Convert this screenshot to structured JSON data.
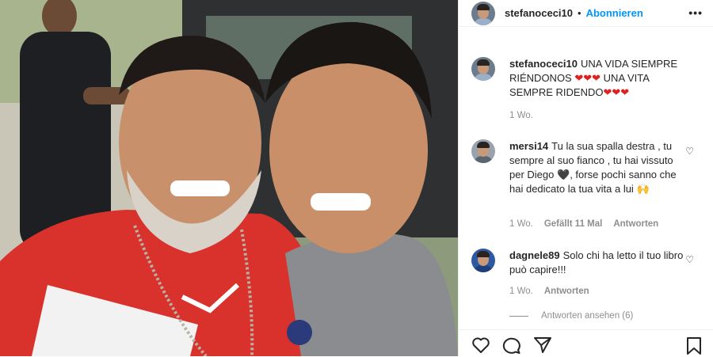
{
  "post": {
    "username": "stefanoceci10",
    "separator": "•",
    "follow_label": "Abonnieren",
    "more_label": "•••"
  },
  "caption": {
    "username": "stefanoceci10",
    "text_part1": "UNA VIDA SIEMPRE RIÉNDONOS",
    "hearts": "❤❤❤",
    "text_part2": "UNA VITA SEMPRE RIDENDO",
    "time": "1 Wo."
  },
  "comments": [
    {
      "username": "mersi14",
      "text_a": "Tu la sua spalla destra , tu sempre al suo fianco , tu hai vissuto per Diego",
      "emoji_heart": "🖤",
      "text_b": ", forse pochi sanno che hai dedicato la tua vita a lui",
      "emoji_end": "🙌",
      "time": "1 Wo.",
      "likes": "Gefällt 11 Mal",
      "reply": "Antworten"
    },
    {
      "username": "dagnele89",
      "text": "Solo chi ha letto il tuo libro può capire!!!",
      "time": "1 Wo.",
      "reply": "Antworten"
    }
  ],
  "view_replies": "Antworten ansehen (6)",
  "icons": {
    "like": "heart-outline-icon",
    "comment": "comment-icon",
    "share": "paper-plane-icon",
    "save": "bookmark-icon",
    "more": "more-options-icon"
  },
  "colors": {
    "accent": "#0095f6",
    "muted": "#8e8e8e",
    "text": "#262626",
    "heart": "#e02020"
  }
}
